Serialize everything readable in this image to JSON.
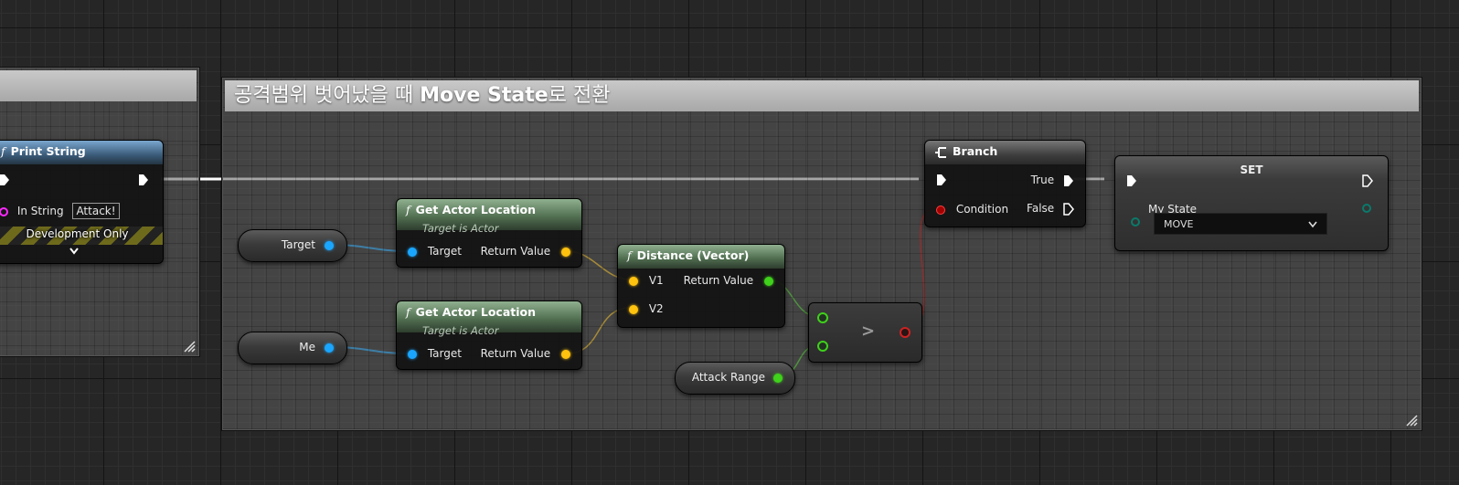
{
  "comment_left": {
    "title": ""
  },
  "comment_main": {
    "title_prefix": "공격범위 벗어났을 때 ",
    "title_bold": "Move State",
    "title_suffix": "로 전환"
  },
  "print_string": {
    "title": "Print String",
    "in_string_label": "In String",
    "in_string_value": "Attack!",
    "dev_only": "Development Only"
  },
  "var_target": {
    "label": "Target"
  },
  "var_me": {
    "label": "Me"
  },
  "var_attack_range": {
    "label": "Attack Range"
  },
  "get_actor_location_1": {
    "title": "Get Actor Location",
    "subtitle": "Target is Actor",
    "input_label": "Target",
    "output_label": "Return Value"
  },
  "get_actor_location_2": {
    "title": "Get Actor Location",
    "subtitle": "Target is Actor",
    "input_label": "Target",
    "output_label": "Return Value"
  },
  "distance": {
    "title": "Distance (Vector)",
    "v1_label": "V1",
    "v2_label": "V2",
    "output_label": "Return Value"
  },
  "compare": {
    "symbol": ">"
  },
  "branch": {
    "title": "Branch",
    "condition_label": "Condition",
    "true_label": "True",
    "false_label": "False"
  },
  "set_node": {
    "title": "SET",
    "var_label": "My State",
    "value": "MOVE"
  },
  "colors": {
    "exec": "#ffffff",
    "object": "#1aa6ff",
    "vector": "#ffc20e",
    "float": "#3fd11b",
    "bool": "#a30000",
    "string": "#ff29ff",
    "enum": "#0a7a6a"
  },
  "icons": [
    "function-icon",
    "branch-icon",
    "exec-pin-icon",
    "chevron-down-icon",
    "resize-grip-icon"
  ]
}
